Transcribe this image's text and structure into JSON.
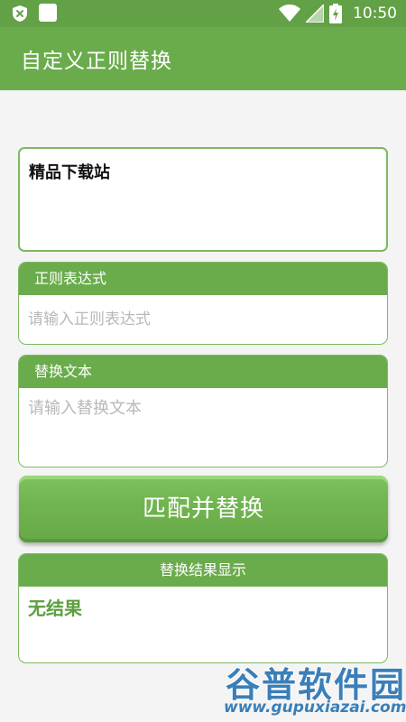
{
  "status_bar": {
    "time": "10:50",
    "icons": [
      "shield-x-icon",
      "app-notification-icon",
      "wifi-icon",
      "signal-icon",
      "battery-icon"
    ]
  },
  "app_bar": {
    "title": "自定义正则替换"
  },
  "source_input": {
    "value": "精品下载站"
  },
  "regex_card": {
    "header": "正则表达式",
    "placeholder": "请输入正则表达式"
  },
  "replace_card": {
    "header": "替换文本",
    "placeholder": "请输入替换文本"
  },
  "action_button": {
    "label": "匹配并替换"
  },
  "result_card": {
    "header": "替换结果显示",
    "value": "无结果"
  },
  "watermark": {
    "title": "谷普软件园",
    "url": "www.gupuxiazai.com"
  },
  "colors": {
    "status_bar": "#63a147",
    "app_bar": "#6aac4c",
    "card_header": "#6aac4c",
    "border": "#7db862",
    "result_text": "#5d9f40",
    "placeholder": "#b8b8b8",
    "background": "#f4f4f4"
  }
}
